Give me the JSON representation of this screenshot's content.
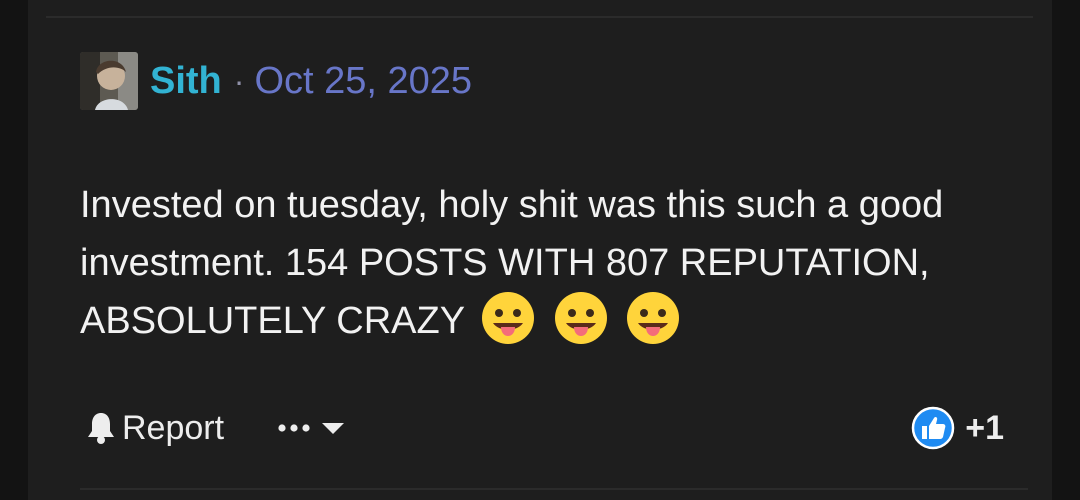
{
  "post": {
    "author": "Sith",
    "separator": "·",
    "date": "Oct 25, 2025",
    "body_text": "Invested on tuesday, holy shit was this such a good investment. 154 POSTS WITH 807 REPUTATION, ABSOLUTELY CRAZY",
    "emojis": [
      "face-with-tongue-emoji",
      "face-with-tongue-emoji",
      "face-with-tongue-emoji"
    ]
  },
  "footer": {
    "report_label": "Report",
    "report_icon": "bell-icon",
    "more_icon": "ellipsis-icon",
    "dropdown_icon": "caret-down-icon",
    "reaction_icon": "thumbs-up-icon",
    "reaction_count": "+1"
  },
  "colors": {
    "author": "#32b3d3",
    "date": "#6876c8",
    "text": "#f2f2f2",
    "reaction": "#1f8bf2",
    "card_background": "#1e1e1e",
    "page_background": "#131313"
  }
}
